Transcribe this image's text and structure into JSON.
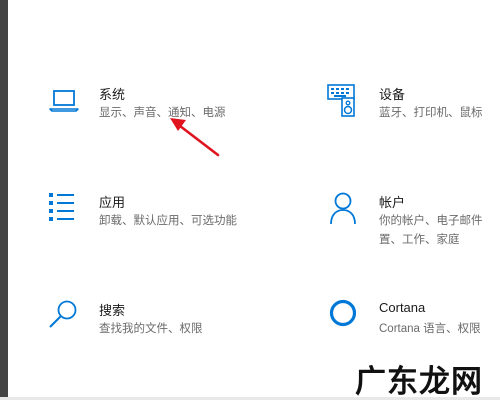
{
  "colors": {
    "accent": "#0078d7",
    "title_text": "#1a1a1a",
    "desc_text": "#6b6b6b",
    "annotation_arrow": "#e0141e"
  },
  "tiles": {
    "system": {
      "title": "系统",
      "desc": "显示、声音、通知、电源",
      "icon": "laptop-icon"
    },
    "devices": {
      "title": "设备",
      "desc": "蓝牙、打印机、鼠标",
      "icon": "keyboard-speaker-icon"
    },
    "apps": {
      "title": "应用",
      "desc": "卸载、默认应用、可选功能",
      "icon": "list-icon"
    },
    "accounts": {
      "title": "帐户",
      "desc1": "你的帐户、电子邮件",
      "desc2": "置、工作、家庭",
      "icon": "person-icon"
    },
    "search": {
      "title": "搜索",
      "desc": "查找我的文件、权限",
      "icon": "search-icon"
    },
    "cortana": {
      "title": "Cortana",
      "desc": "Cortana 语言、权限",
      "icon": "cortana-circle-icon"
    }
  },
  "annotation": {
    "arrow": "red-arrow"
  },
  "watermark": {
    "text": "广东龙网"
  }
}
